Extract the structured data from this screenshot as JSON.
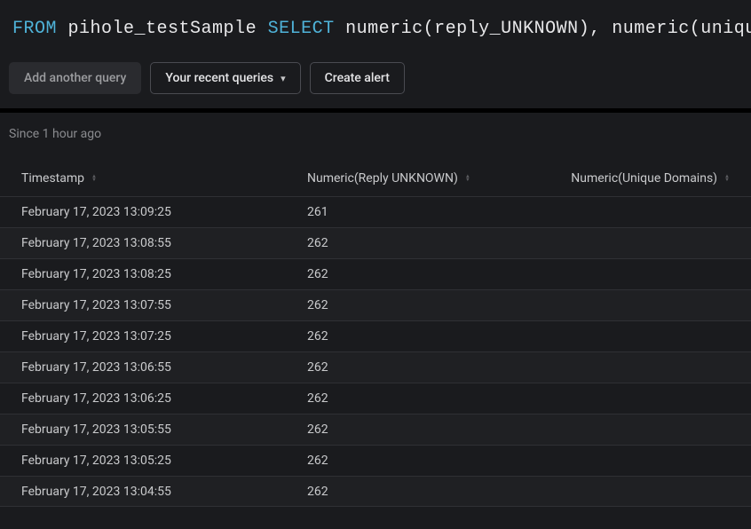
{
  "query": {
    "from_kw": "FROM",
    "table": "pihole_testSample",
    "select_kw": "SELECT",
    "expr_func1": "numeric",
    "expr_arg1": "reply_UNKNOWN",
    "expr_func2": "numeric",
    "expr_arg2": "unique_domains",
    "comma": ","
  },
  "toolbar": {
    "add_query": "Add another query",
    "recent": "Your recent queries",
    "create_alert": "Create alert"
  },
  "meta": {
    "since": "Since 1 hour ago"
  },
  "columns": {
    "timestamp": "Timestamp",
    "colA": "Numeric(Reply UNKNOWN)",
    "colB": "Numeric(Unique Domains)"
  },
  "rows": [
    {
      "ts": "February 17, 2023 13:09:25",
      "a": "261",
      "b": ""
    },
    {
      "ts": "February 17, 2023 13:08:55",
      "a": "262",
      "b": ""
    },
    {
      "ts": "February 17, 2023 13:08:25",
      "a": "262",
      "b": ""
    },
    {
      "ts": "February 17, 2023 13:07:55",
      "a": "262",
      "b": ""
    },
    {
      "ts": "February 17, 2023 13:07:25",
      "a": "262",
      "b": ""
    },
    {
      "ts": "February 17, 2023 13:06:55",
      "a": "262",
      "b": ""
    },
    {
      "ts": "February 17, 2023 13:06:25",
      "a": "262",
      "b": ""
    },
    {
      "ts": "February 17, 2023 13:05:55",
      "a": "262",
      "b": ""
    },
    {
      "ts": "February 17, 2023 13:05:25",
      "a": "262",
      "b": ""
    },
    {
      "ts": "February 17, 2023 13:04:55",
      "a": "262",
      "b": ""
    }
  ]
}
